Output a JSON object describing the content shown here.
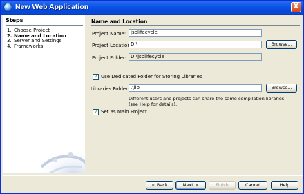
{
  "window": {
    "title": "New Web Application",
    "close_glyph": "X"
  },
  "steps": {
    "heading": "Steps",
    "items": [
      {
        "num": "1.",
        "label": "Choose Project"
      },
      {
        "num": "2.",
        "label": "Name and Location"
      },
      {
        "num": "3.",
        "label": "Server and Settings"
      },
      {
        "num": "4.",
        "label": "Frameworks"
      }
    ]
  },
  "main": {
    "heading": "Name and Location",
    "project_name": {
      "label": "Project Name:",
      "value": "jsplifecycle"
    },
    "project_location": {
      "label": "Project Location:",
      "value": "D:\\",
      "browse": "Browse..."
    },
    "project_folder": {
      "label": "Project Folder:",
      "value": "D:\\jsplifecycle"
    },
    "dedicated_folder": {
      "label": "Use Dedicated Folder for Storing Libraries",
      "checked": true
    },
    "libraries_folder": {
      "label": "Libraries Folder:",
      "value": ".\\lib",
      "browse": "Browse..."
    },
    "libraries_help": "Different users and projects can share the same compilation libraries (see Help for details).",
    "main_project": {
      "label": "Set as Main Project",
      "checked": true
    }
  },
  "footer": {
    "back": "< Back",
    "next": "Next >",
    "finish": "Finish",
    "cancel": "Cancel",
    "help": "Help"
  },
  "colors": {
    "titlebar": "#0a53e6",
    "background": "#ece9d8",
    "check": "#21a121"
  }
}
